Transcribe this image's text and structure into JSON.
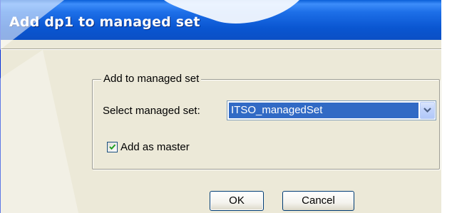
{
  "dialog": {
    "title": "Add dp1 to managed set"
  },
  "group": {
    "legend": "Add to managed set",
    "select_label": "Select managed set:",
    "selected_value": "ITSO_managedSet",
    "checkbox_label": "Add as master",
    "checkbox_checked": true
  },
  "buttons": {
    "ok": "OK",
    "cancel": "Cancel"
  },
  "icons": {
    "dropdown": "chevron-down-icon",
    "checkmark": "checkmark-icon"
  },
  "colors": {
    "titlebar": "#0a56d1",
    "selection": "#316ac5",
    "dialog_bg": "#ece9d8"
  }
}
